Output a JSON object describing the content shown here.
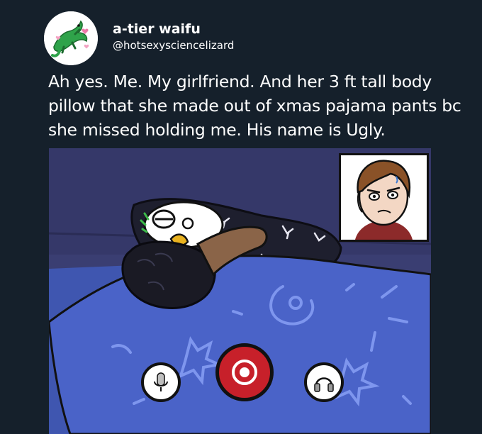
{
  "tweet": {
    "display_name": "a-tier waifu",
    "handle": "@hotsexysciencelizard",
    "avatar_icon": "green-lizard-with-hearts-icon",
    "text": "Ah yes. Me. My girlfriend. And her 3 ft tall body pillow that she made out of xmas pajama pants bc she missed holding me. His name is Ugly."
  },
  "comic": {
    "call_controls": [
      {
        "name": "microphone",
        "icon": "microphone-icon"
      },
      {
        "name": "record",
        "icon": "record-icon",
        "color": "#c7202a"
      },
      {
        "name": "headphones",
        "icon": "headphones-icon"
      }
    ],
    "colors": {
      "background": "#15202b",
      "wall": "#3a3e72",
      "blanket": "#4a63c8",
      "pillow": "#1e1f2e"
    }
  }
}
